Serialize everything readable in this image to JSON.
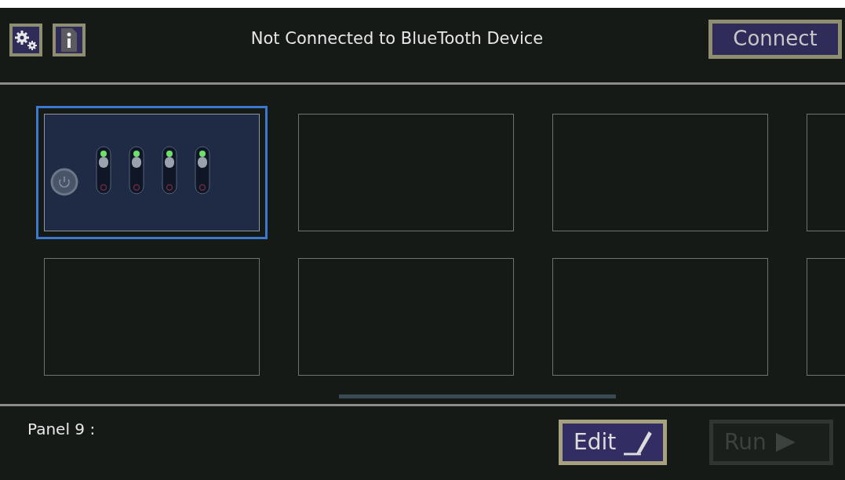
{
  "header": {
    "settings_button": {
      "enabled": true
    },
    "info_button": {
      "enabled": true
    },
    "status": "Not Connected to BlueTooth Device",
    "connect_button": "Connect"
  },
  "panels": [
    {
      "kind": "switches",
      "selected": true,
      "switches": [
        {
          "on": true
        },
        {
          "on": true
        },
        {
          "on": true
        },
        {
          "on": true
        }
      ]
    },
    {
      "kind": "empty",
      "selected": false
    },
    {
      "kind": "empty",
      "selected": false
    },
    {
      "kind": "empty",
      "selected": false
    },
    {
      "kind": "empty",
      "selected": false
    },
    {
      "kind": "empty",
      "selected": false
    },
    {
      "kind": "empty",
      "selected": false
    },
    {
      "kind": "empty",
      "selected": false
    }
  ],
  "footer": {
    "panel_label": "Panel 9 :",
    "edit_button": {
      "label": "Edit",
      "disabled": false
    },
    "run_button": {
      "label": "Run",
      "disabled": true
    }
  }
}
